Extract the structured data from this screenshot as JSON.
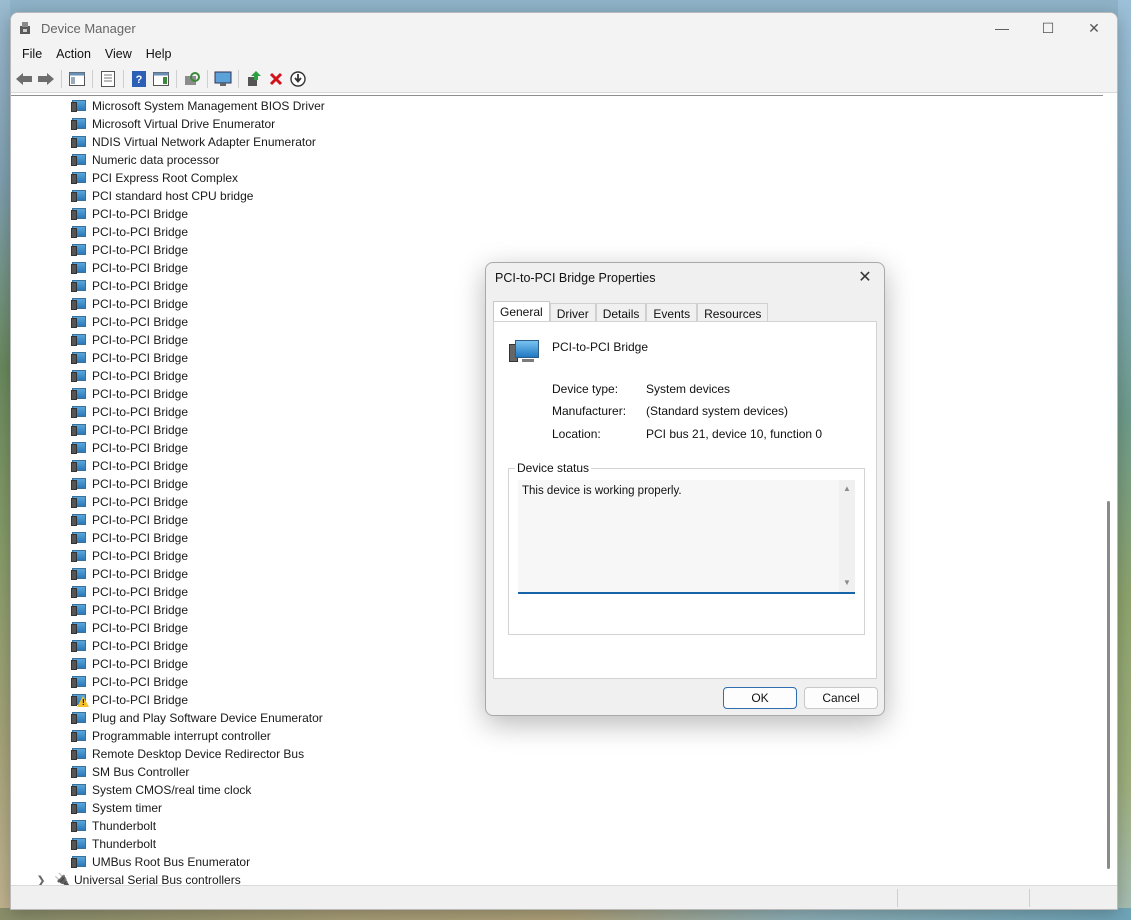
{
  "window": {
    "title": "Device Manager",
    "menu": [
      "File",
      "Action",
      "View",
      "Help"
    ],
    "caption_minimize": "—",
    "caption_maximize": "☐",
    "caption_close": "✕"
  },
  "tree": {
    "devices": [
      {
        "label": "Microsoft System Management BIOS Driver",
        "warning": false
      },
      {
        "label": "Microsoft Virtual Drive Enumerator",
        "warning": false
      },
      {
        "label": "NDIS Virtual Network Adapter Enumerator",
        "warning": false
      },
      {
        "label": "Numeric data processor",
        "warning": false
      },
      {
        "label": "PCI Express Root Complex",
        "warning": false
      },
      {
        "label": "PCI standard host CPU bridge",
        "warning": false
      },
      {
        "label": "PCI-to-PCI Bridge",
        "warning": false
      },
      {
        "label": "PCI-to-PCI Bridge",
        "warning": false
      },
      {
        "label": "PCI-to-PCI Bridge",
        "warning": false
      },
      {
        "label": "PCI-to-PCI Bridge",
        "warning": false
      },
      {
        "label": "PCI-to-PCI Bridge",
        "warning": false
      },
      {
        "label": "PCI-to-PCI Bridge",
        "warning": false
      },
      {
        "label": "PCI-to-PCI Bridge",
        "warning": false
      },
      {
        "label": "PCI-to-PCI Bridge",
        "warning": false
      },
      {
        "label": "PCI-to-PCI Bridge",
        "warning": false
      },
      {
        "label": "PCI-to-PCI Bridge",
        "warning": false
      },
      {
        "label": "PCI-to-PCI Bridge",
        "warning": false
      },
      {
        "label": "PCI-to-PCI Bridge",
        "warning": false
      },
      {
        "label": "PCI-to-PCI Bridge",
        "warning": false
      },
      {
        "label": "PCI-to-PCI Bridge",
        "warning": false
      },
      {
        "label": "PCI-to-PCI Bridge",
        "warning": false
      },
      {
        "label": "PCI-to-PCI Bridge",
        "warning": false
      },
      {
        "label": "PCI-to-PCI Bridge",
        "warning": false
      },
      {
        "label": "PCI-to-PCI Bridge",
        "warning": false
      },
      {
        "label": "PCI-to-PCI Bridge",
        "warning": false
      },
      {
        "label": "PCI-to-PCI Bridge",
        "warning": false
      },
      {
        "label": "PCI-to-PCI Bridge",
        "warning": false
      },
      {
        "label": "PCI-to-PCI Bridge",
        "warning": false
      },
      {
        "label": "PCI-to-PCI Bridge",
        "warning": false
      },
      {
        "label": "PCI-to-PCI Bridge",
        "warning": false
      },
      {
        "label": "PCI-to-PCI Bridge",
        "warning": false
      },
      {
        "label": "PCI-to-PCI Bridge",
        "warning": false
      },
      {
        "label": "PCI-to-PCI Bridge",
        "warning": false
      },
      {
        "label": "PCI-to-PCI Bridge",
        "warning": true
      },
      {
        "label": "Plug and Play Software Device Enumerator",
        "warning": false
      },
      {
        "label": "Programmable interrupt controller",
        "warning": false
      },
      {
        "label": "Remote Desktop Device Redirector Bus",
        "warning": false
      },
      {
        "label": "SM Bus Controller",
        "warning": false
      },
      {
        "label": "System CMOS/real time clock",
        "warning": false
      },
      {
        "label": "System timer",
        "warning": false
      },
      {
        "label": "Thunderbolt",
        "warning": false
      },
      {
        "label": "Thunderbolt",
        "warning": false
      },
      {
        "label": "UMBus Root Bus Enumerator",
        "warning": false
      }
    ],
    "category": {
      "label": "Universal Serial Bus controllers",
      "expanded": false
    }
  },
  "dialog": {
    "title": "PCI-to-PCI Bridge Properties",
    "close": "✕",
    "tabs": [
      "General",
      "Driver",
      "Details",
      "Events",
      "Resources"
    ],
    "active_tab": "General",
    "device_name": "PCI-to-PCI Bridge",
    "properties": [
      {
        "label": "Device type:",
        "value": "System devices"
      },
      {
        "label": "Manufacturer:",
        "value": "(Standard system devices)"
      },
      {
        "label": "Location:",
        "value": "PCI bus 21, device 10, function 0"
      }
    ],
    "status_group_label": "Device status",
    "status_text": "This device is working properly.",
    "ok_label": "OK",
    "cancel_label": "Cancel"
  },
  "colors": {
    "accent": "#1565a8",
    "warning": "#f5c12e",
    "delete_red": "#d0121b"
  }
}
